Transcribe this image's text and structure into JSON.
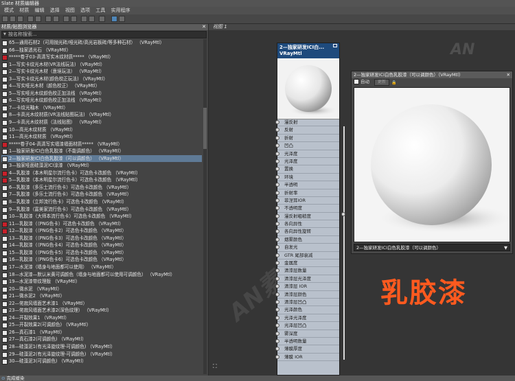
{
  "window": {
    "title": "Slate 材质编辑器"
  },
  "menu": [
    "模式",
    "材质",
    "编辑",
    "选择",
    "视图",
    "选项",
    "工具",
    "实用程序"
  ],
  "browser": {
    "title": "材质/贴图浏览器",
    "close": "✕",
    "search_placeholder": "按名称搜索...",
    "items": [
      "65—通用石材2（可用抛光砖/哑光砖/高光岩板砖/等多种石材）   （VRayMtl）",
      "66—独家透光石   （VRayMtl）",
      "*****卷子03-高清写实木纹材质*****   （VRayMtl）",
      "1—写实卡纹光木材(VR法线玩法)   （VRayMtl）",
      "2—写实卡纹光木材（意境玩法）   （VRayMtl）",
      "3—写实卡纹光木材(颜色校正玩法)   （VRayMtl）",
      "4—写实哑光木材（颜色校正）   （VRayMtl）",
      "5—写实哑光木纹颜色校正加法线   （VRayMtl）",
      "6—写实哑光木纹颜色校正加法线   （VRayMtl）",
      "7—卡纹光釉木   （VRayMtl）",
      "8—卡高光木纹材质(VR法线贴图玩法)   （VRayMtl）",
      "9—卡高光木纹材质（法线贴图）   （VRayMtl）",
      "10—高光木纹材质   （VRayMtl）",
      "11—高光木纹材质   （VRayMtl）",
      "*****卷子04-高清写实墙漆墙面材质*****   （VRayMtl）",
      "1—独家研发ICI白色乳胶漆（不能调颜色）   （VRayMtl）",
      "2—独家研发ICI白色乳胶漆（可以调颜色）   （VRayMtl）",
      "3—独家哑面硅藻泥ICI涂漆   （VRayMtl）",
      "4—乳胶漆（本木明星尔流行色卡）可选色卡改颜色   （VRayMtl）",
      "5—乳胶漆（本木明星尔流行色卡）可选色卡改颜色   （VRayMtl）",
      "6—乳胶漆（多乐士流行色卡）可选色卡改颜色   （VRayMtl）",
      "7—乳胶漆（多乐士流行色卡）可选色卡改颜色   （VRayMtl）",
      "8—乳胶漆（立邦流行色卡）可选色卡改颜色   （VRayMtl）",
      "9—乳胶漆（富美家流行色卡）可选色卡改颜色   （VRayMtl）",
      "10—乳胶漆（大师本流行色卡）可选色卡改颜色   （VRayMtl）",
      "11—乳胶漆（（PNG色卡）可选色卡改颜色   （VRayMtl）",
      "12—乳胶漆（（PNG色卡2）可选色卡改颜色   （VRayMtl）",
      "13—乳胶漆（（PNG色卡3）可选色卡改颜色   （VRayMtl）",
      "14—乳胶漆（（PNG色卡4）可选色卡改颜色   （VRayMtl）",
      "15—乳胶漆（（PNG色卡5）可选色卡改颜色   （VRayMtl）",
      "16—乳胶漆（（PNG色卡6）可选色卡改颜色   （VRayMtl）",
      "17—水泥漆（墙身与地面都可以使用）   （VRayMtl）",
      "18—水泥漆—默认米黄可调颜色（墙身与地面都可以使用可调颜色）   （VRayMtl）",
      "19—水泥漆带纹理版   （VRayMtl）",
      "20—微水泥   （VRayMtl）",
      "21—微水泥2   （VRayMtl）",
      "22—侘寂风墙面艺术漆1   （VRayMtl）",
      "23—侘寂风墙面艺术漆2(深色纹理）   （VRayMtl）",
      "24—开裂效果1   （VRayMtl）",
      "25—开裂效果2(可调颜色)   （VRayMtl）",
      "26—真石漆1   （VRayMtl）",
      "27—真石漆2(可调颜色)   （VRayMtl）",
      "28—硅藻泥1(有光泽旋纹理-可调颜色)   （VRayMtl）",
      "29—硅藻泥2(有光泽旋纹理-可调颜色)   （VRayMtl）",
      "30—硅藻泥3(可调颜色)   （VRayMtl）"
    ]
  },
  "view": {
    "tab_label": "视图 1"
  },
  "node": {
    "title": "2—独家研发ICI白...",
    "type": "VRayMtl",
    "slots": [
      "漫反射",
      "反射",
      "折射",
      "凹凸",
      "光泽度",
      "光泽度",
      "置换",
      "环境",
      "半透明",
      "折射率",
      "菲涅耳IOR",
      "不透明度",
      "漫反射粗糙度",
      "各向异性",
      "各向异性旋转",
      "烟雾颜色",
      "自发光",
      "GTR 尾部衰减",
      "金属度",
      "清漆层数量",
      "清漆层光泽度",
      "清漆层 IOR",
      "清漆层颜色",
      "清漆层凹凸",
      "光泽颜色",
      "光泽光泽度",
      "光泽层凹凸",
      "雾深度",
      "半透明数量",
      "薄膜厚度",
      "薄膜 IOR"
    ]
  },
  "preview": {
    "title": "2—独家研发ICI白色乳胶漆（可以调颜色）（VRayMtl）",
    "close": "✕",
    "auto_label": "自动",
    "update_label": "更新",
    "selected": "2—独家研发ICI白色乳胶漆（可以调颜色）",
    "arrow": "▼"
  },
  "overlay": {
    "big_text": "乳胶漆",
    "watermark": "AN",
    "watermark2": "AN素材"
  },
  "status": {
    "icon": "⊙",
    "text": "完成缓染"
  },
  "colors": {
    "node_header": "#1e4a7c",
    "selection": "#5f7a96",
    "accent_text": "#ff5a1f"
  }
}
